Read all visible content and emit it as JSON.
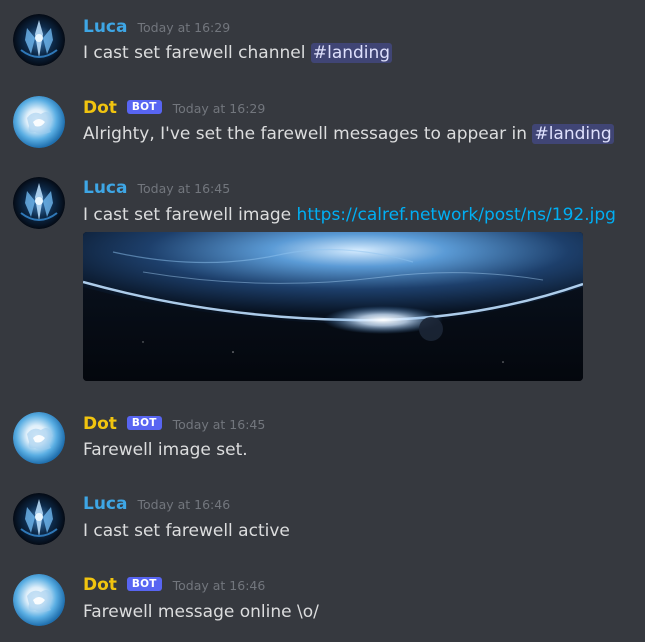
{
  "messages": [
    {
      "author": "Luca",
      "time": "Today at 16:29",
      "text": "I cast set farewell channel ",
      "mention": "#landing"
    },
    {
      "author": "Dot",
      "bot_tag": "BOT",
      "time": "Today at 16:29",
      "text": "Alrighty, I've set the farewell messages to appear in ",
      "mention": "#landing"
    },
    {
      "author": "Luca",
      "time": "Today at 16:45",
      "text": "I cast set farewell image ",
      "link": "https://calref.network/post/ns/192.jpg"
    },
    {
      "author": "Dot",
      "bot_tag": "BOT",
      "time": "Today at 16:45",
      "text": "Farewell image set."
    },
    {
      "author": "Luca",
      "time": "Today at 16:46",
      "text": "I cast set farewell active"
    },
    {
      "author": "Dot",
      "bot_tag": "BOT",
      "time": "Today at 16:46",
      "text": "Farewell message online \\o/"
    }
  ],
  "colors": {
    "background": "#36393f",
    "luca": "#3ea6e5",
    "dot": "#f1c40f",
    "bot_tag": "#5865f2",
    "link": "#00aff4"
  },
  "icons": {
    "luca_avatar": "luca-avatar-icon",
    "dot_avatar": "dot-avatar-icon"
  }
}
